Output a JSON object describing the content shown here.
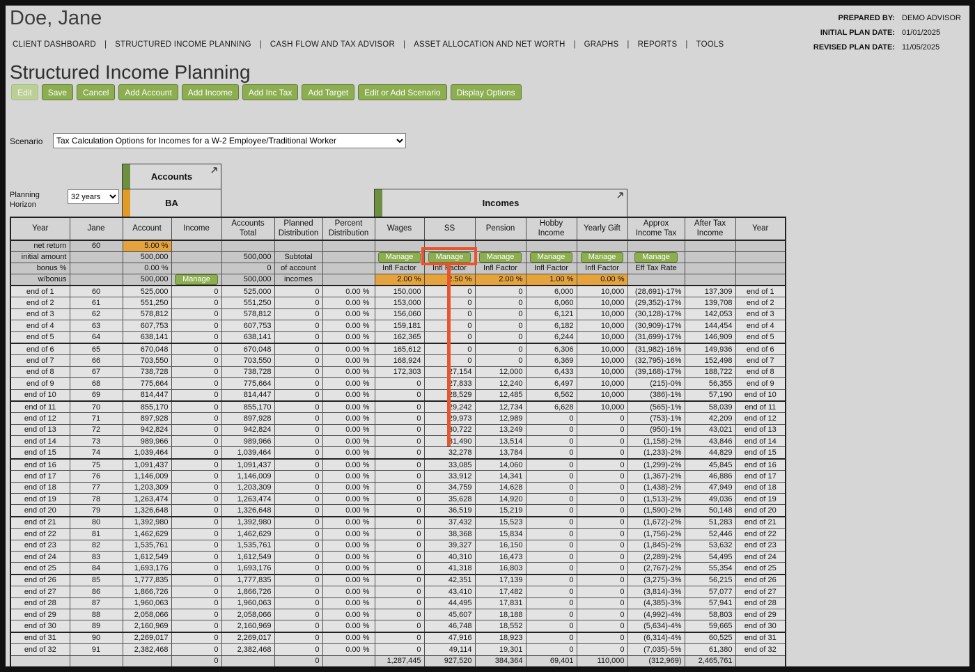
{
  "header": {
    "client_name": "Doe, Jane",
    "prepared_by_label": "PREPARED BY:",
    "prepared_by_value": "DEMO ADVISOR",
    "initial_plan_date_label": "INITIAL PLAN DATE:",
    "initial_plan_date_value": "01/01/2025",
    "revised_plan_date_label": "REVISED PLAN DATE:",
    "revised_plan_date_value": "11/05/2025"
  },
  "nav": {
    "items": [
      "CLIENT DASHBOARD",
      "STRUCTURED INCOME PLANNING",
      "CASH FLOW AND TAX ADVISOR",
      "ASSET ALLOCATION AND NET WORTH",
      "GRAPHS",
      "REPORTS",
      "TOOLS"
    ]
  },
  "page": {
    "title": "Structured Income Planning"
  },
  "toolbar": {
    "buttons": [
      "Edit",
      "Save",
      "Cancel",
      "Add Account",
      "Add Income",
      "Add Inc Tax",
      "Add Target",
      "Edit or Add Scenario",
      "Display Options"
    ]
  },
  "scenario": {
    "label": "Scenario",
    "value": "Tax Calculation Options for Incomes for a W-2 Employee/Traditional Worker"
  },
  "planning_horizon": {
    "label": "Planning Horizon",
    "value": "32 years"
  },
  "groups": {
    "accounts": "Accounts",
    "account_code": "BA",
    "incomes": "Incomes"
  },
  "table": {
    "manage_label": "Manage",
    "columns": [
      "Year",
      "Jane",
      "Account",
      "Income",
      "Accounts Total",
      "Planned Distribution",
      "Percent Distribution",
      "Wages",
      "SS",
      "Pension",
      "Hobby Income",
      "Yearly Gift",
      "Approx Income Tax",
      "After Tax Income",
      "Year"
    ],
    "meta": {
      "net_return": {
        "label": "net return",
        "jane": "60",
        "account": "5.00 %"
      },
      "initial_amount": {
        "label": "initial amount",
        "account": "500,000",
        "accounts_total": "500,000",
        "planned": "Subtotal"
      },
      "bonus": {
        "label": "bonus %",
        "account": "0.00 %",
        "accounts_total": "0",
        "planned": "of account",
        "infl_factor": "Infl Factor",
        "eff_tax_rate": "Eff Tax Rate"
      },
      "w_bonus": {
        "label": "w/bonus",
        "account": "500,000",
        "accounts_total": "500,000",
        "planned": "incomes",
        "infl": {
          "wages": "2.00 %",
          "ss": "2.50 %",
          "pension": "2.00 %",
          "hobby": "1.00 %",
          "gift": "0.00 %"
        }
      }
    },
    "rows": [
      [
        "end of 1",
        "60",
        "525,000",
        "0",
        "525,000",
        "0",
        "0.00 %",
        "150,000",
        "0",
        "0",
        "6,000",
        "10,000",
        "(28,691)-17%",
        "137,309",
        "end of 1"
      ],
      [
        "end of 2",
        "61",
        "551,250",
        "0",
        "551,250",
        "0",
        "0.00 %",
        "153,000",
        "0",
        "0",
        "6,060",
        "10,000",
        "(29,352)-17%",
        "139,708",
        "end of 2"
      ],
      [
        "end of 3",
        "62",
        "578,812",
        "0",
        "578,812",
        "0",
        "0.00 %",
        "156,060",
        "0",
        "0",
        "6,121",
        "10,000",
        "(30,128)-17%",
        "142,053",
        "end of 3"
      ],
      [
        "end of 4",
        "63",
        "607,753",
        "0",
        "607,753",
        "0",
        "0.00 %",
        "159,181",
        "0",
        "0",
        "6,182",
        "10,000",
        "(30,909)-17%",
        "144,454",
        "end of 4"
      ],
      [
        "end of 5",
        "64",
        "638,141",
        "0",
        "638,141",
        "0",
        "0.00 %",
        "162,365",
        "0",
        "0",
        "6,244",
        "10,000",
        "(31,699)-17%",
        "146,909",
        "end of 5"
      ],
      [
        "end of 6",
        "65",
        "670,048",
        "0",
        "670,048",
        "0",
        "0.00 %",
        "165,612",
        "0",
        "0",
        "6,306",
        "10,000",
        "(31,982)-16%",
        "149,936",
        "end of 6"
      ],
      [
        "end of 7",
        "66",
        "703,550",
        "0",
        "703,550",
        "0",
        "0.00 %",
        "168,924",
        "0",
        "0",
        "6,369",
        "10,000",
        "(32,795)-16%",
        "152,498",
        "end of 7"
      ],
      [
        "end of 8",
        "67",
        "738,728",
        "0",
        "738,728",
        "0",
        "0.00 %",
        "172,303",
        "27,154",
        "12,000",
        "6,433",
        "10,000",
        "(39,168)-17%",
        "188,722",
        "end of 8"
      ],
      [
        "end of 9",
        "68",
        "775,664",
        "0",
        "775,664",
        "0",
        "0.00 %",
        "0",
        "27,833",
        "12,240",
        "6,497",
        "10,000",
        "(215)-0%",
        "56,355",
        "end of 9"
      ],
      [
        "end of 10",
        "69",
        "814,447",
        "0",
        "814,447",
        "0",
        "0.00 %",
        "0",
        "28,529",
        "12,485",
        "6,562",
        "10,000",
        "(386)-1%",
        "57,190",
        "end of 10"
      ],
      [
        "end of 11",
        "70",
        "855,170",
        "0",
        "855,170",
        "0",
        "0.00 %",
        "0",
        "29,242",
        "12,734",
        "6,628",
        "10,000",
        "(565)-1%",
        "58,039",
        "end of 11"
      ],
      [
        "end of 12",
        "71",
        "897,928",
        "0",
        "897,928",
        "0",
        "0.00 %",
        "0",
        "29,973",
        "12,989",
        "0",
        "0",
        "(753)-1%",
        "42,209",
        "end of 12"
      ],
      [
        "end of 13",
        "72",
        "942,824",
        "0",
        "942,824",
        "0",
        "0.00 %",
        "0",
        "30,722",
        "13,249",
        "0",
        "0",
        "(950)-1%",
        "43,021",
        "end of 13"
      ],
      [
        "end of 14",
        "73",
        "989,966",
        "0",
        "989,966",
        "0",
        "0.00 %",
        "0",
        "31,490",
        "13,514",
        "0",
        "0",
        "(1,158)-2%",
        "43,846",
        "end of 14"
      ],
      [
        "end of 15",
        "74",
        "1,039,464",
        "0",
        "1,039,464",
        "0",
        "0.00 %",
        "0",
        "32,278",
        "13,784",
        "0",
        "0",
        "(1,233)-2%",
        "44,829",
        "end of 15"
      ],
      [
        "end of 16",
        "75",
        "1,091,437",
        "0",
        "1,091,437",
        "0",
        "0.00 %",
        "0",
        "33,085",
        "14,060",
        "0",
        "0",
        "(1,299)-2%",
        "45,845",
        "end of 16"
      ],
      [
        "end of 17",
        "76",
        "1,146,009",
        "0",
        "1,146,009",
        "0",
        "0.00 %",
        "0",
        "33,912",
        "14,341",
        "0",
        "0",
        "(1,367)-2%",
        "46,886",
        "end of 17"
      ],
      [
        "end of 18",
        "77",
        "1,203,309",
        "0",
        "1,203,309",
        "0",
        "0.00 %",
        "0",
        "34,759",
        "14,628",
        "0",
        "0",
        "(1,438)-2%",
        "47,949",
        "end of 18"
      ],
      [
        "end of 19",
        "78",
        "1,263,474",
        "0",
        "1,263,474",
        "0",
        "0.00 %",
        "0",
        "35,628",
        "14,920",
        "0",
        "0",
        "(1,513)-2%",
        "49,036",
        "end of 19"
      ],
      [
        "end of 20",
        "79",
        "1,326,648",
        "0",
        "1,326,648",
        "0",
        "0.00 %",
        "0",
        "36,519",
        "15,219",
        "0",
        "0",
        "(1,590)-2%",
        "50,148",
        "end of 20"
      ],
      [
        "end of 21",
        "80",
        "1,392,980",
        "0",
        "1,392,980",
        "0",
        "0.00 %",
        "0",
        "37,432",
        "15,523",
        "0",
        "0",
        "(1,672)-2%",
        "51,283",
        "end of 21"
      ],
      [
        "end of 22",
        "81",
        "1,462,629",
        "0",
        "1,462,629",
        "0",
        "0.00 %",
        "0",
        "38,368",
        "15,834",
        "0",
        "0",
        "(1,756)-2%",
        "52,446",
        "end of 22"
      ],
      [
        "end of 23",
        "82",
        "1,535,761",
        "0",
        "1,535,761",
        "0",
        "0.00 %",
        "0",
        "39,327",
        "16,150",
        "0",
        "0",
        "(1,845)-2%",
        "53,632",
        "end of 23"
      ],
      [
        "end of 24",
        "83",
        "1,612,549",
        "0",
        "1,612,549",
        "0",
        "0.00 %",
        "0",
        "40,310",
        "16,473",
        "0",
        "0",
        "(2,289)-2%",
        "54,495",
        "end of 24"
      ],
      [
        "end of 25",
        "84",
        "1,693,176",
        "0",
        "1,693,176",
        "0",
        "0.00 %",
        "0",
        "41,318",
        "16,803",
        "0",
        "0",
        "(2,767)-2%",
        "55,354",
        "end of 25"
      ],
      [
        "end of 26",
        "85",
        "1,777,835",
        "0",
        "1,777,835",
        "0",
        "0.00 %",
        "0",
        "42,351",
        "17,139",
        "0",
        "0",
        "(3,275)-3%",
        "56,215",
        "end of 26"
      ],
      [
        "end of 27",
        "86",
        "1,866,726",
        "0",
        "1,866,726",
        "0",
        "0.00 %",
        "0",
        "43,410",
        "17,482",
        "0",
        "0",
        "(3,814)-3%",
        "57,077",
        "end of 27"
      ],
      [
        "end of 28",
        "87",
        "1,960,063",
        "0",
        "1,960,063",
        "0",
        "0.00 %",
        "0",
        "44,495",
        "17,831",
        "0",
        "0",
        "(4,385)-3%",
        "57,941",
        "end of 28"
      ],
      [
        "end of 29",
        "88",
        "2,058,066",
        "0",
        "2,058,066",
        "0",
        "0.00 %",
        "0",
        "45,607",
        "18,188",
        "0",
        "0",
        "(4,992)-4%",
        "58,803",
        "end of 29"
      ],
      [
        "end of 30",
        "89",
        "2,160,969",
        "0",
        "2,160,969",
        "0",
        "0.00 %",
        "0",
        "46,748",
        "18,552",
        "0",
        "0",
        "(5,634)-4%",
        "59,665",
        "end of 30"
      ],
      [
        "end of 31",
        "90",
        "2,269,017",
        "0",
        "2,269,017",
        "0",
        "0.00 %",
        "0",
        "47,916",
        "18,923",
        "0",
        "0",
        "(6,314)-4%",
        "60,525",
        "end of 31"
      ],
      [
        "end of 32",
        "91",
        "2,382,468",
        "0",
        "2,382,468",
        "0",
        "0.00 %",
        "0",
        "49,114",
        "19,301",
        "0",
        "0",
        "(7,035)-5%",
        "61,380",
        "end of 32"
      ]
    ],
    "totals": [
      "",
      "",
      "",
      "0",
      "",
      "0",
      "",
      "1,287,445",
      "927,520",
      "384,364",
      "69,401",
      "110,000",
      "(312,969)",
      "2,465,761",
      ""
    ]
  }
}
